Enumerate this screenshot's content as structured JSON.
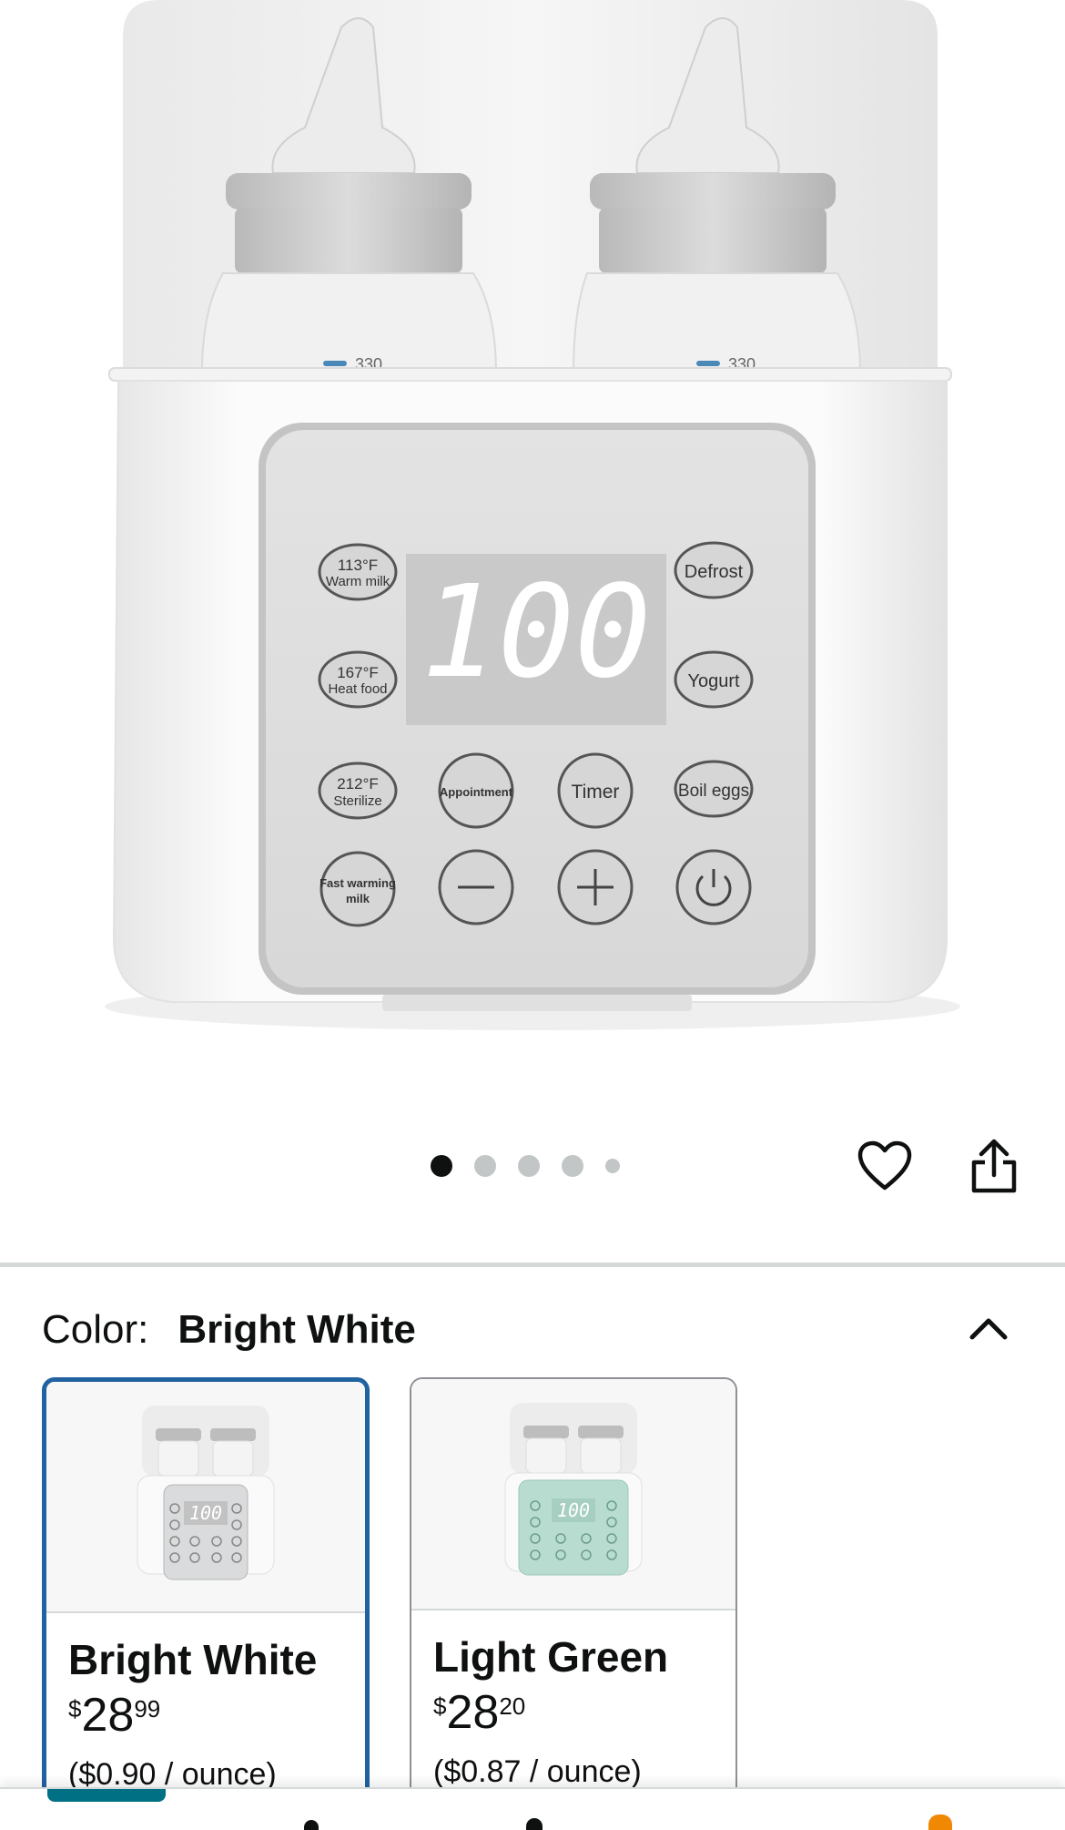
{
  "product_image": {
    "bottle_left_marking": "330",
    "bottle_right_marking": "330",
    "display_readout": "100",
    "panel_buttons": [
      {
        "id": "warm-milk",
        "line1": "113°F",
        "line2": "Warm milk"
      },
      {
        "id": "heat-food",
        "line1": "167°F",
        "line2": "Heat food"
      },
      {
        "id": "sterilize",
        "line1": "212°F",
        "line2": "Sterilize"
      },
      {
        "id": "fast-warming",
        "line1": "Fast warming",
        "line2": "milk"
      },
      {
        "id": "defrost",
        "line1": "Defrost"
      },
      {
        "id": "yogurt",
        "line1": "Yogurt"
      },
      {
        "id": "boil-eggs",
        "line1": "Boil eggs"
      },
      {
        "id": "appointment",
        "line1": "Appointment"
      },
      {
        "id": "timer",
        "line1": "Timer"
      }
    ]
  },
  "carousel": {
    "total": 5,
    "active_index": 0
  },
  "actions": {
    "wishlist_icon": "heart-outline-icon",
    "share_icon": "share-icon"
  },
  "color": {
    "label": "Color:",
    "selected": "Bright White",
    "collapse_icon": "chevron-up-icon",
    "options": [
      {
        "name": "Bright White",
        "currency": "$",
        "whole": "28",
        "fraction": "99",
        "unit_price": "($0.90 / ounce)",
        "accent": "#d9dbdc",
        "selected": true
      },
      {
        "name": "Light Green",
        "currency": "$",
        "whole": "28",
        "fraction": "20",
        "unit_price": "($0.87 / ounce)",
        "accent": "#b8ddd0",
        "selected": false
      }
    ]
  },
  "colors": {
    "selected_border": "#2162a1",
    "accent_teal": "#007185",
    "cart_orange": "#f08804",
    "text": "#0f1111"
  }
}
